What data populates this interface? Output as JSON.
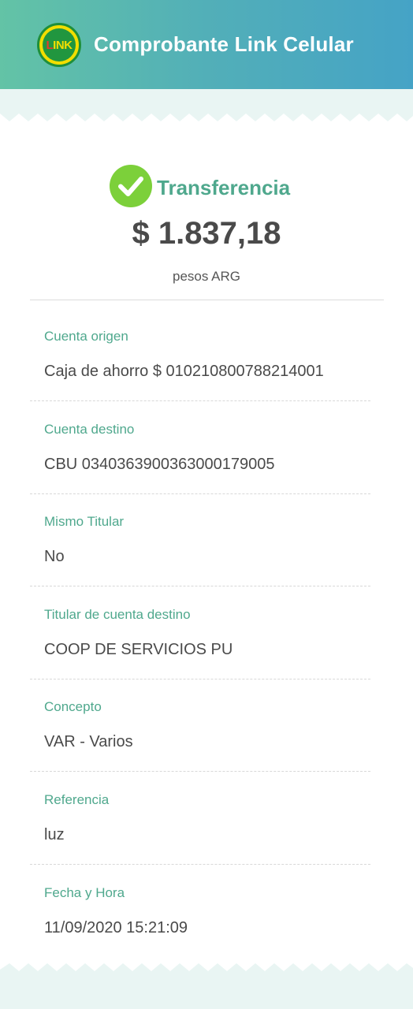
{
  "header": {
    "title": "Comprobante Link Celular",
    "logo_text": "LINK"
  },
  "summary": {
    "type_label": "Transferencia",
    "amount": "$ 1.837,18",
    "currency_label": "pesos ARG"
  },
  "details": [
    {
      "label": "Cuenta origen",
      "value": "Caja de ahorro $ 010210800788214001"
    },
    {
      "label": "Cuenta destino",
      "value": "CBU 0340363900363000179005"
    },
    {
      "label": "Mismo Titular",
      "value": "No"
    },
    {
      "label": "Titular de cuenta destino",
      "value": "COOP DE SERVICIOS PU"
    },
    {
      "label": "Concepto",
      "value": "VAR - Varios"
    },
    {
      "label": "Referencia",
      "value": "luz"
    },
    {
      "label": "Fecha y Hora",
      "value": "11/09/2020 15:21:09"
    }
  ],
  "colors": {
    "accent": "#4fa88d",
    "success": "#7cd03a",
    "header_start": "#63c3a6",
    "header_end": "#45a3c6"
  }
}
